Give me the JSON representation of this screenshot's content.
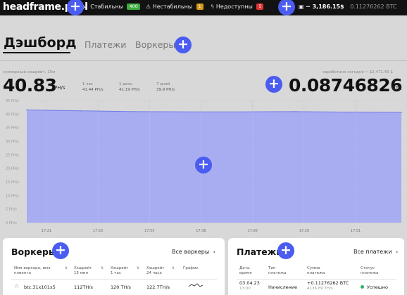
{
  "topbar": {
    "logo": "headframe.pool",
    "stable_label": "Стабильны",
    "stable_count": "400",
    "unstable_label": "Нестабильны",
    "unstable_count": "1",
    "offline_label": "Недоступны",
    "offline_count": "5",
    "balance_usd": "~ 3,186.15$",
    "balance_btc": "0.11276262 BTC",
    "colors": {
      "stable": "#3cab3c",
      "unstable": "#d99a1a",
      "offline": "#e03434"
    }
  },
  "tabs": [
    {
      "label": "Дэшборд",
      "active": true
    },
    {
      "label": "Платежи",
      "active": false
    },
    {
      "label": "Воркеры",
      "active": false
    }
  ],
  "stats": {
    "total_label": "суммарный хэшрейт, 15м",
    "total_value": "40.83",
    "total_unit": "PH/s",
    "h1_label": "1 час",
    "h1_value": "41.44 PH/s",
    "d1_label": "1 день",
    "d1_value": "41.19 PH/s",
    "d7_label": "7 дней",
    "d7_value": "39.9 PH/s",
    "earned_label": "заработано сегодня ~ $2,471.45 $",
    "earned_value": "0.08746826",
    "earned_unit": "BTC"
  },
  "chart_data": {
    "type": "area",
    "title": "",
    "xlabel": "",
    "ylabel": "",
    "y_ticks": [
      "0 PH/s",
      "5 PH/s",
      "10 PH/s",
      "15 PH/s",
      "20 PH/s",
      "25 PH/s",
      "30 PH/s",
      "35 PH/s",
      "40 PH/s",
      "45 PH/s"
    ],
    "ylim": [
      0,
      45
    ],
    "x_ticks": [
      "17:21",
      "17:53",
      "17:55",
      "17:36",
      "17:06",
      "17:20",
      "17:51"
    ],
    "x": [
      "17:21",
      "17:53",
      "17:55",
      "17:36",
      "17:06",
      "17:20",
      "17:51"
    ],
    "series": [
      {
        "values": [
          41.5,
          41.2,
          40.9,
          40.8,
          40.8,
          40.9,
          40.7,
          40.6
        ]
      }
    ],
    "fill_color": "#9fa6f5",
    "line_color": "#6f7ae8",
    "grid": true
  },
  "workers": {
    "title": "Воркеры",
    "all_link": "Все воркеры",
    "columns": [
      "Имя воркера, имя клиента",
      "Хэшрейт 15 мин",
      "Хэшрейт 1 час",
      "Хэшрейт 24 часа",
      "График"
    ],
    "rows": [
      {
        "name": "btc.31x101x5",
        "h15": "112TH/s",
        "h1": "120 TH/s",
        "h24": "122.7TH/s"
      }
    ]
  },
  "payments": {
    "title": "Платежи",
    "all_link": "Все платежи",
    "columns": [
      "Дата, время",
      "Тип платежа",
      "Сумма платежа",
      "Статус платежа"
    ],
    "rows": [
      {
        "date": "03.04.23",
        "time": "13:00",
        "type": "Начисление",
        "amount": "+0.11276262 BTC",
        "amount_usd": "4136.89 TH/s",
        "status": "Успешно"
      }
    ]
  },
  "icons": [
    "plus-icon",
    "check-icon",
    "warning-icon",
    "lightning-icon",
    "wallet-icon",
    "chevron-right-icon",
    "star-icon",
    "sort-icon",
    "sparkline-icon"
  ]
}
